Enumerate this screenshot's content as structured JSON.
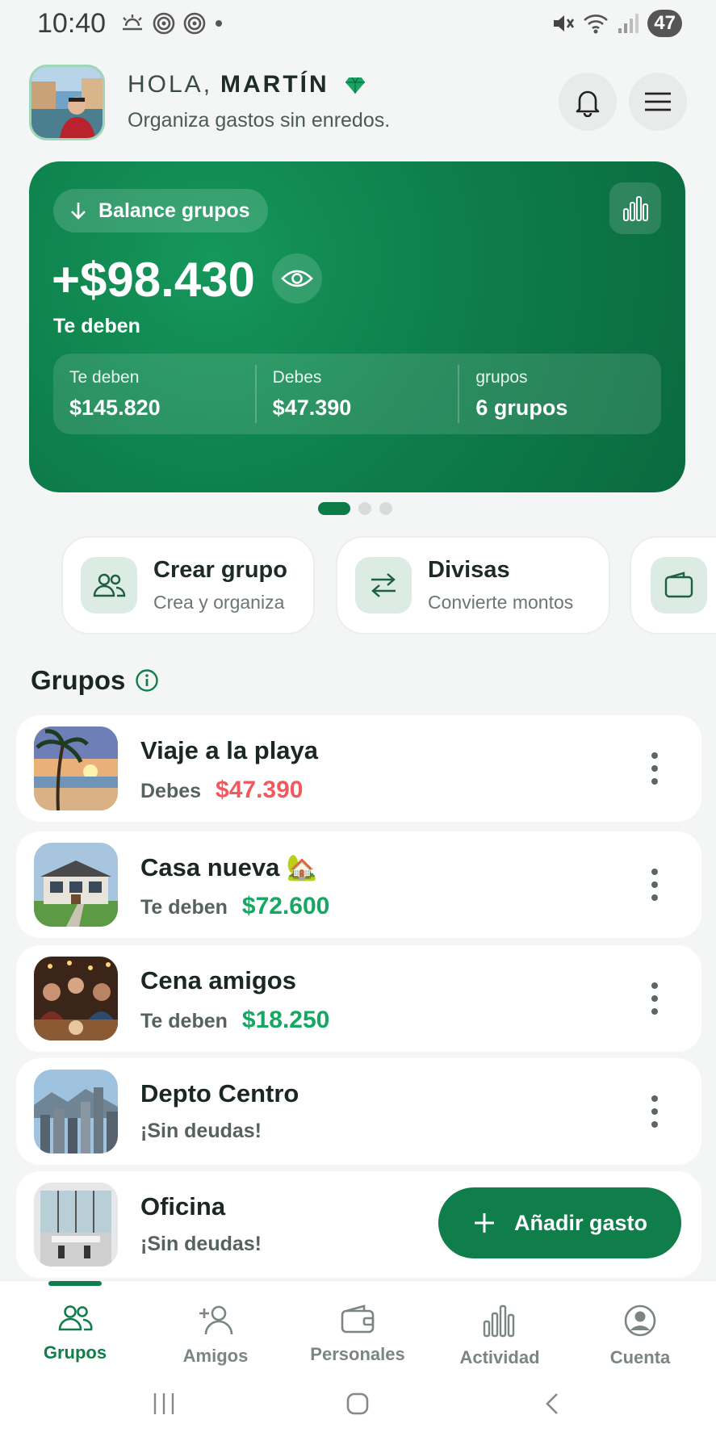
{
  "status_bar": {
    "time": "10:40",
    "battery": "47"
  },
  "header": {
    "greeting": "HOLA,",
    "name": "MARTÍN",
    "tagline": "Organiza gastos sin enredos."
  },
  "balance_card": {
    "pill_label": "Balance grupos",
    "amount": "+$98.430",
    "subtitle": "Te deben",
    "stats": [
      {
        "label": "Te deben",
        "value": "$145.820"
      },
      {
        "label": "Debes",
        "value": "$47.390"
      },
      {
        "label": "grupos",
        "value": "6 grupos"
      }
    ]
  },
  "carousel": {
    "pages": 3,
    "active": 0
  },
  "quick_actions": [
    {
      "title": "Crear grupo",
      "subtitle": "Crea y organiza",
      "icon": "people-icon"
    },
    {
      "title": "Divisas",
      "subtitle": "Convierte montos",
      "icon": "swap-icon"
    },
    {
      "title": "",
      "subtitle": "",
      "icon": "wallet-icon"
    }
  ],
  "groups_section": {
    "title": "Grupos"
  },
  "groups": [
    {
      "name": "Viaje a la playa",
      "status": "Debes",
      "amount": "$47.390",
      "tone": "negative"
    },
    {
      "name": "Casa nueva 🏡",
      "status": "Te deben",
      "amount": "$72.600",
      "tone": "positive"
    },
    {
      "name": "Cena amigos",
      "status": "Te deben",
      "amount": "$18.250",
      "tone": "positive"
    },
    {
      "name": "Depto Centro",
      "status": "¡Sin deudas!",
      "amount": "",
      "tone": "neutral"
    },
    {
      "name": "Oficina",
      "status": "¡Sin deudas!",
      "amount": "",
      "tone": "neutral"
    }
  ],
  "fab": {
    "label": "Añadir gasto"
  },
  "bottom_nav": [
    {
      "label": "Grupos",
      "active": true
    },
    {
      "label": "Amigos",
      "active": false
    },
    {
      "label": "Personales",
      "active": false
    },
    {
      "label": "Actividad",
      "active": false
    },
    {
      "label": "Cuenta",
      "active": false
    }
  ],
  "colors": {
    "brand": "#0f7e4a",
    "negative": "#ef5a5e",
    "positive": "#16a762"
  }
}
